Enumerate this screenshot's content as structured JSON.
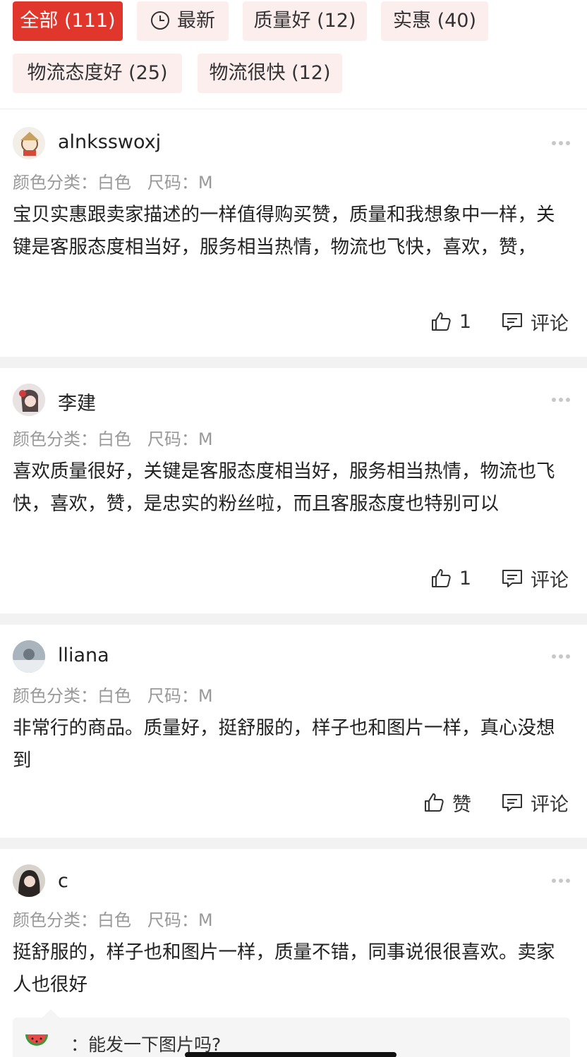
{
  "filters": {
    "all": "全部 (111)",
    "latest": "最新",
    "quality": "质量好 (12)",
    "value": "实惠 (40)",
    "service": "物流态度好 (25)",
    "fast": "物流很快 (12)",
    "active_color": "#e0362c"
  },
  "reviews": [
    {
      "user": "alnksswoxj",
      "sku": "颜色分类：白色   尺码：M",
      "content": "宝贝实惠跟卖家描述的一样值得购买赞，质量和我想象中一样，关键是客服态度相当好，服务相当热情，物流也飞快，喜欢，赞，",
      "likes": "1",
      "comment": "评论"
    },
    {
      "user": "李建",
      "sku": "颜色分类：白色   尺码：M",
      "content": "喜欢质量很好，关键是客服态度相当好，服务相当热情，物流也飞快，喜欢，赞，是忠实的粉丝啦，而且客服态度也特别可以",
      "likes": "1",
      "comment": "评论"
    },
    {
      "user": "lliana",
      "sku": "颜色分类：白色   尺码：M",
      "content": "非常行的商品。质量好，挺舒服的，样子也和图片一样，真心没想到",
      "likes": "赞",
      "comment": "评论"
    },
    {
      "user": "c",
      "sku": "颜色分类：白色   尺码：M",
      "content": "挺舒服的，样子也和图片一样，质量不错，同事说很很喜欢。卖家人也很好",
      "reply": "：能发一下图片吗?"
    }
  ]
}
